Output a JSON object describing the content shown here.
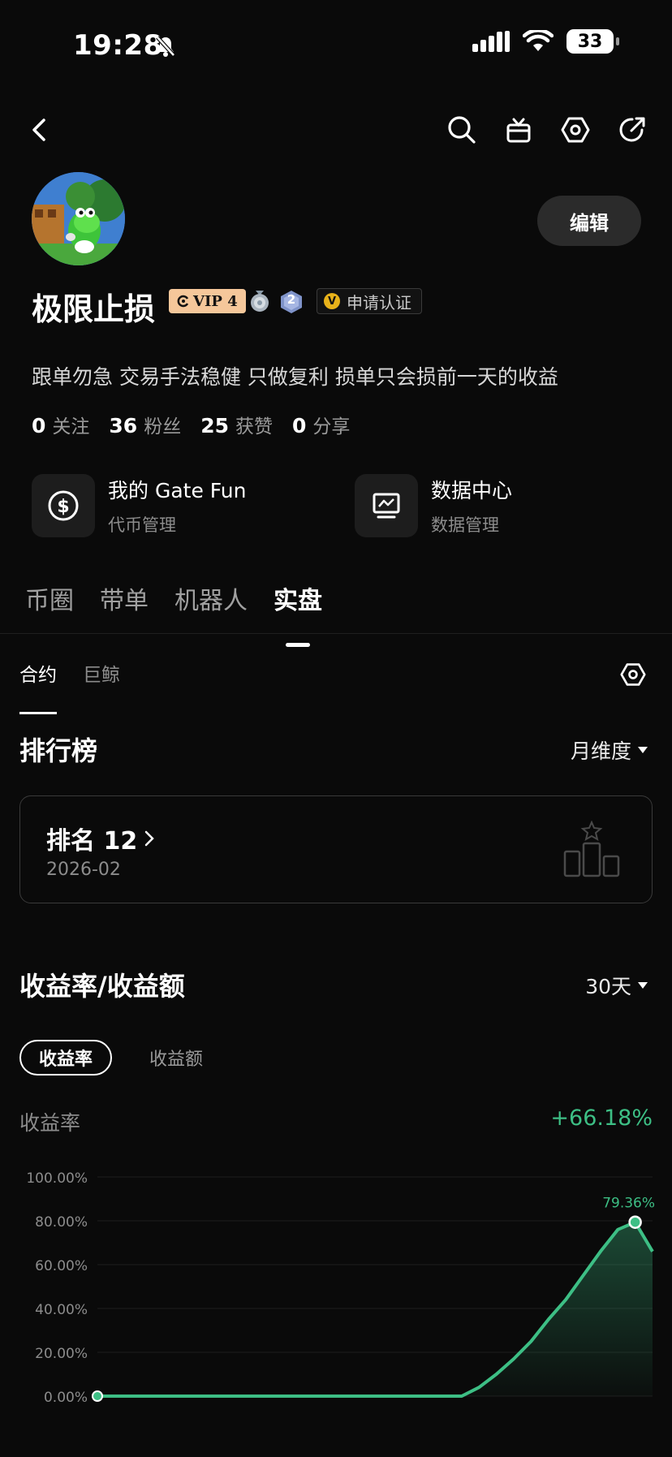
{
  "status_bar": {
    "time": "19:28",
    "battery": "33"
  },
  "profile": {
    "username": "极限止损",
    "vip": "VIP 4",
    "medal_level": "2",
    "verify": "申请认证",
    "edit": "编辑",
    "bio": "跟单勿急 交易手法稳健 只做复利 损单只会损前一天的收益",
    "stats": [
      {
        "value": "0",
        "label": "关注"
      },
      {
        "value": "36",
        "label": "粉丝"
      },
      {
        "value": "25",
        "label": "获赞"
      },
      {
        "value": "0",
        "label": "分享"
      }
    ]
  },
  "tools": [
    {
      "title": "我的 Gate Fun",
      "subtitle": "代币管理",
      "icon": "dollar-coin-icon"
    },
    {
      "title": "数据中心",
      "subtitle": "数据管理",
      "icon": "chart-monitor-icon"
    }
  ],
  "tabs": [
    "币圈",
    "带单",
    "机器人",
    "实盘"
  ],
  "active_tab": "实盘",
  "subtabs": [
    "合约",
    "巨鲸"
  ],
  "ranking": {
    "title": "排行榜",
    "period": "月维度",
    "rank_label": "排名 12",
    "date": "2026-02"
  },
  "returns": {
    "title": "收益率/收益额",
    "period": "30天",
    "pills": [
      "收益率",
      "收益额"
    ],
    "metric_label": "收益率",
    "metric_value": "+66.18%"
  },
  "colors": {
    "accent_green": "#3dbf85",
    "background": "#0a0a0a"
  },
  "chart_data": {
    "type": "area",
    "y_ticks": [
      "100.00%",
      "80.00%",
      "60.00%",
      "40.00%",
      "20.00%",
      "0.00%"
    ],
    "ylim": [
      0,
      100
    ],
    "x": [
      1,
      2,
      3,
      4,
      5,
      6,
      7,
      8,
      9,
      10,
      11,
      12,
      13,
      14,
      15,
      16,
      17,
      18,
      19,
      20,
      21,
      22,
      23,
      24,
      25,
      26,
      27,
      28,
      29,
      30
    ],
    "values": [
      0,
      0,
      0,
      0,
      0,
      0,
      0,
      0,
      0,
      0,
      0,
      0,
      0,
      0,
      0,
      0,
      0,
      0,
      0,
      0,
      0,
      0,
      4,
      10,
      17,
      25,
      35,
      44,
      55,
      66,
      76,
      79.36,
      66
    ],
    "peak_label": "79.36%",
    "grid": true
  }
}
